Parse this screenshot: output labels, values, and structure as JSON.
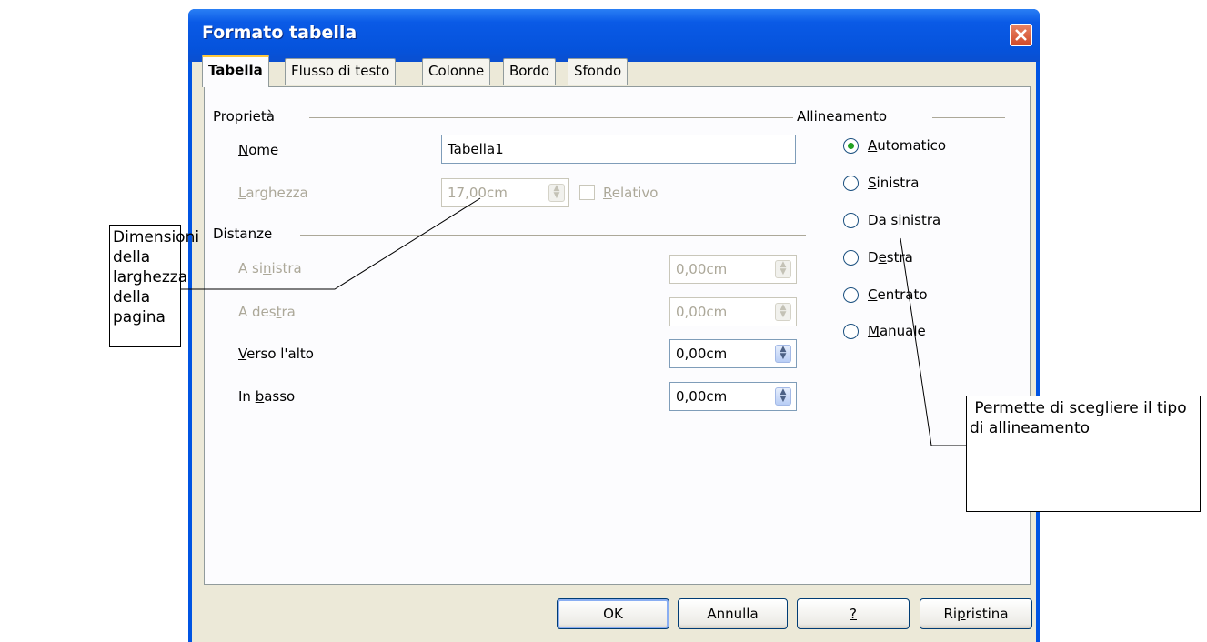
{
  "window": {
    "title": "Formato tabella"
  },
  "tabs": [
    {
      "label": "Tabella",
      "active": true
    },
    {
      "label": "Flusso di testo",
      "active": false
    },
    {
      "label": "Colonne",
      "active": false
    },
    {
      "label": "Bordo",
      "active": false
    },
    {
      "label": "Sfondo",
      "active": false
    }
  ],
  "properties": {
    "group_label": "Proprietà",
    "name_label_u": "N",
    "name_label_rest": "ome",
    "name_value": "Tabella1",
    "width_label_u": "L",
    "width_label_rest": "arghezza",
    "width_value": "17,00cm",
    "relative_label_u": "R",
    "relative_label_rest": "elativo"
  },
  "spacing": {
    "group_label": "Distanze",
    "left_label_a": "A si",
    "left_label_u": "n",
    "left_label_b": "istra",
    "left_value": "0,00cm",
    "right_label_a": "A des",
    "right_label_u": "t",
    "right_label_b": "ra",
    "right_value": "0,00cm",
    "top_label_u": "V",
    "top_label_rest": "erso l'alto",
    "top_value": "0,00cm",
    "bottom_label_a": "In ",
    "bottom_label_u": "b",
    "bottom_label_b": "asso",
    "bottom_value": "0,00cm"
  },
  "alignment": {
    "group_label": "Allineamento",
    "options": [
      {
        "u": "A",
        "rest": "utomatico",
        "pre": "",
        "checked": true
      },
      {
        "u": "S",
        "rest": "inistra",
        "pre": "",
        "checked": false
      },
      {
        "u": "D",
        "rest": "a sinistra",
        "pre": "",
        "checked": false
      },
      {
        "pre": "D",
        "u": "e",
        "rest": "stra",
        "checked": false
      },
      {
        "u": "C",
        "rest": "entrato",
        "pre": "",
        "checked": false
      },
      {
        "u": "M",
        "rest": "anuale",
        "pre": "",
        "checked": false
      }
    ]
  },
  "buttons": {
    "ok": "OK",
    "cancel": "Annulla",
    "help": "?",
    "reset_a": "Ri",
    "reset_u": "p",
    "reset_b": "ristina"
  },
  "annotations": {
    "width_note": "Dimensioni della larghezza della pagina",
    "alignment_note": " Permette di scegliere il tipo di allineamento"
  }
}
